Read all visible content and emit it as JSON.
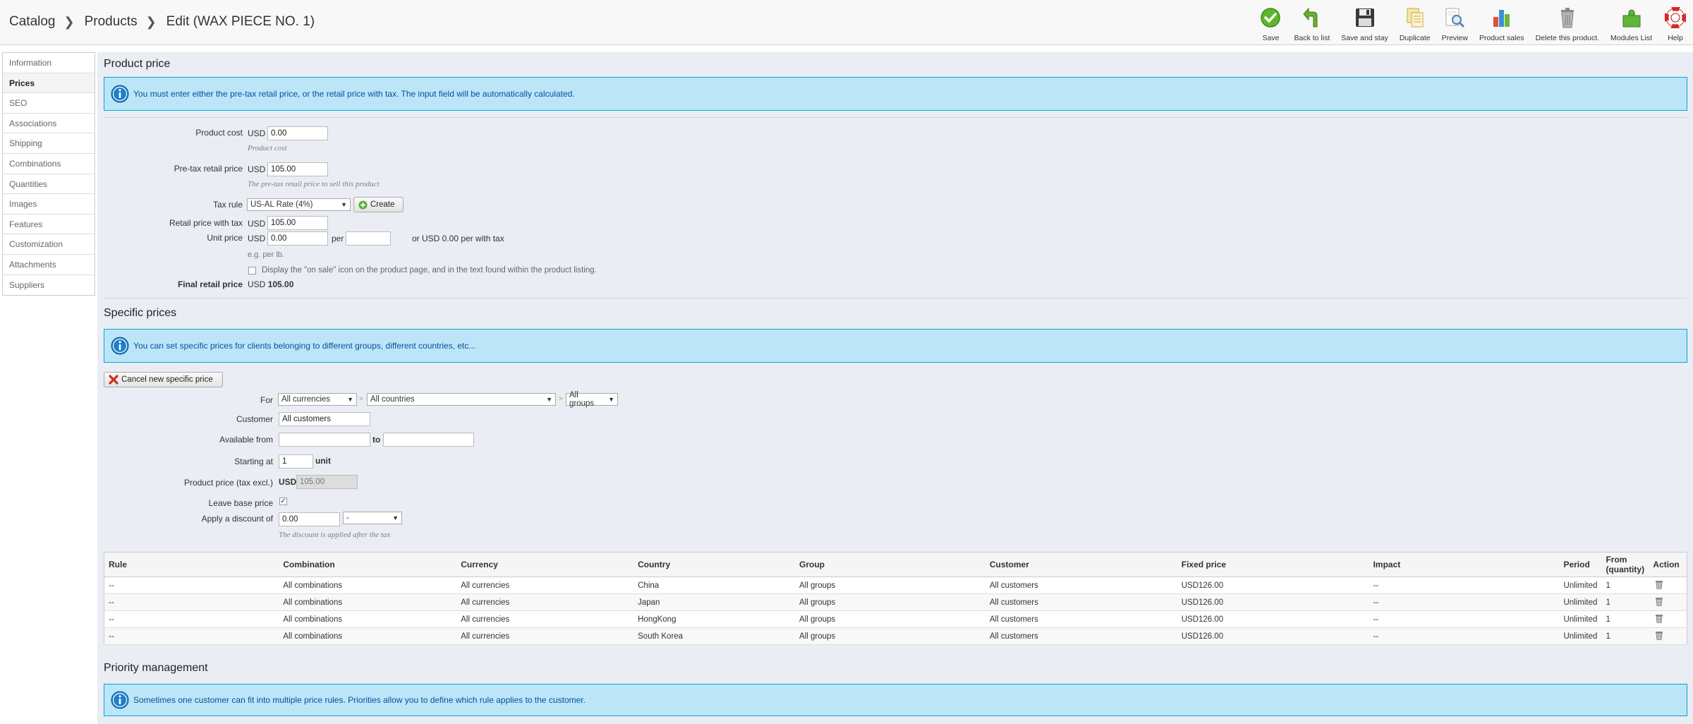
{
  "breadcrumb": {
    "level1": "Catalog",
    "level2": "Products",
    "level3": "Edit (WAX PIECE NO. 1)"
  },
  "toolbar": [
    {
      "label": "Save",
      "icon": "save-check-icon"
    },
    {
      "label": "Back to list",
      "icon": "back-arrow-icon"
    },
    {
      "label": "Save and stay",
      "icon": "floppy-disk-icon"
    },
    {
      "label": "Duplicate",
      "icon": "duplicate-icon"
    },
    {
      "label": "Preview",
      "icon": "preview-magnifier-icon"
    },
    {
      "label": "Product sales",
      "icon": "bar-chart-icon"
    },
    {
      "label": "Delete this product.",
      "icon": "trash-icon"
    },
    {
      "label": "Modules List",
      "icon": "puzzle-icon"
    },
    {
      "label": "Help",
      "icon": "lifebuoy-icon"
    }
  ],
  "sidebar": {
    "items": [
      "Information",
      "Prices",
      "SEO",
      "Associations",
      "Shipping",
      "Combinations",
      "Quantities",
      "Images",
      "Features",
      "Customization",
      "Attachments",
      "Suppliers"
    ],
    "active": "Prices"
  },
  "product_price": {
    "title": "Product price",
    "info": "You must enter either the pre-tax retail price, or the retail price with tax. The input field will be automatically calculated.",
    "product_cost_label": "Product cost",
    "currency": "USD",
    "product_cost_value": "0.00",
    "product_cost_hint": "Product cost",
    "pretax_label": "Pre-tax retail price",
    "pretax_value": "105.00",
    "pretax_hint": "The pre-tax retail price to sell this product",
    "tax_rule_label": "Tax rule",
    "tax_rule_value": "US-AL Rate (4%)",
    "create_label": "Create",
    "retail_with_tax_label": "Retail price with tax",
    "retail_with_tax_value": "105.00",
    "unit_price_label": "Unit price",
    "unit_price_value": "0.00",
    "per_label": "per",
    "unit_value": "",
    "unit_with_tax_text": "or USD 0.00 per with tax",
    "unit_hint": "e.g. per lb.",
    "on_sale_text": "Display the \"on sale\" icon on the product page, and in the text found within the product listing.",
    "on_sale_checked": false,
    "final_label": "Final retail price",
    "final_currency": "USD",
    "final_value": "105.00"
  },
  "specific_prices": {
    "title": "Specific prices",
    "info": "You can set specific prices for clients belonging to different groups, different countries, etc...",
    "cancel_label": "Cancel new specific price",
    "for_label": "For",
    "currency_select": "All currencies",
    "country_select": "All countries",
    "group_select": "All groups",
    "customer_label": "Customer",
    "customer_value": "All customers",
    "available_label": "Available from",
    "from_value": "",
    "to_label": "to",
    "to_value": "",
    "starting_label": "Starting at",
    "starting_value": "1",
    "unit_label": "unit",
    "price_label": "Product price (tax excl.)",
    "price_currency": "USD",
    "price_value": "105.00",
    "leave_base_label": "Leave base price",
    "leave_base_checked": true,
    "discount_label": "Apply a discount of",
    "discount_value": "0.00",
    "discount_type": "-",
    "discount_hint": "The discount is applied after the tax"
  },
  "table": {
    "columns": [
      "Rule",
      "Combination",
      "Currency",
      "Country",
      "Group",
      "Customer",
      "Fixed price",
      "Impact",
      "Period",
      "From (quantity)",
      "Action"
    ],
    "rows": [
      [
        "--",
        "All combinations",
        "All currencies",
        "China",
        "All groups",
        "All customers",
        "USD126.00",
        "--",
        "Unlimited",
        "1"
      ],
      [
        "--",
        "All combinations",
        "All currencies",
        "Japan",
        "All groups",
        "All customers",
        "USD126.00",
        "--",
        "Unlimited",
        "1"
      ],
      [
        "--",
        "All combinations",
        "All currencies",
        "HongKong",
        "All groups",
        "All customers",
        "USD126.00",
        "--",
        "Unlimited",
        "1"
      ],
      [
        "--",
        "All combinations",
        "All currencies",
        "South Korea",
        "All groups",
        "All customers",
        "USD126.00",
        "--",
        "Unlimited",
        "1"
      ]
    ]
  },
  "priority": {
    "title": "Priority management",
    "info": "Sometimes one customer can fit into multiple price rules. Priorities allow you to define which rule applies to the customer."
  }
}
